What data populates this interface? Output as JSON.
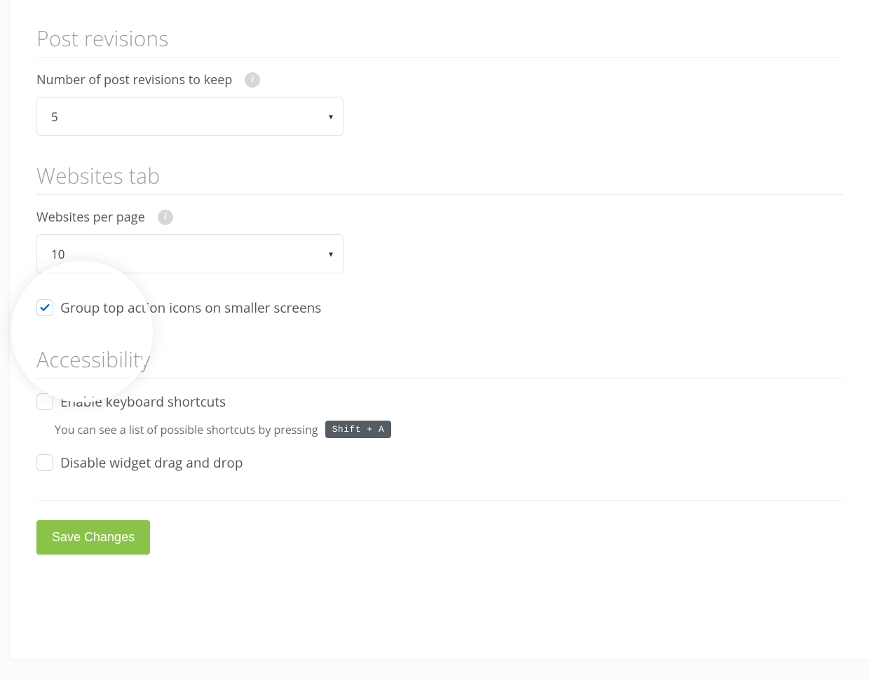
{
  "sections": {
    "post_revisions": {
      "title": "Post revisions",
      "field_label": "Number of post revisions to keep",
      "select_value": "5"
    },
    "websites_tab": {
      "title": "Websites tab",
      "field_label": "Websites per page",
      "select_value": "10",
      "group_icons_label": "Group top action icons on smaller screens",
      "group_icons_checked": true
    },
    "accessibility": {
      "title": "Accessibility",
      "enable_shortcuts_label": "Enable keyboard shortcuts",
      "enable_shortcuts_checked": false,
      "shortcuts_help": "You can see a list of possible shortcuts by pressing",
      "shortcuts_kbd": "Shift + A",
      "disable_dnd_label": "Disable widget drag and drop",
      "disable_dnd_checked": false
    }
  },
  "footer": {
    "save_label": "Save Changes"
  },
  "icons": {
    "info_glyph": "i",
    "caret_glyph": "▾"
  }
}
